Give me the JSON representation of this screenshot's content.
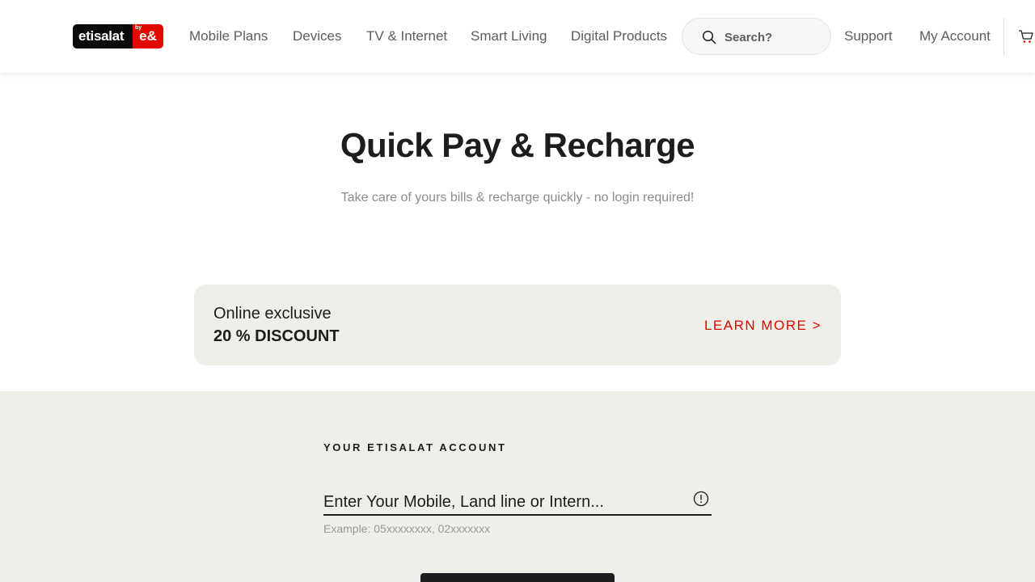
{
  "header": {
    "logo": {
      "text": "etisalat",
      "mark": "e&",
      "by": "by"
    },
    "nav": [
      {
        "label": "Mobile Plans"
      },
      {
        "label": "Devices"
      },
      {
        "label": "TV & Internet"
      },
      {
        "label": "Smart Living"
      },
      {
        "label": "Digital Products"
      }
    ],
    "search": {
      "placeholder": "Search?",
      "icon": "search-icon"
    },
    "links": [
      {
        "label": "Support"
      },
      {
        "label": "My Account"
      }
    ],
    "cart": {
      "icon": "cart-icon"
    }
  },
  "hero": {
    "title": "Quick Pay & Recharge",
    "subtitle": "Take care of yours bills & recharge quickly - no login required!"
  },
  "promo": {
    "line1": "Online exclusive",
    "line2": "20 % DISCOUNT",
    "link": "LEARN MORE >"
  },
  "account": {
    "label": "YOUR ETISALAT ACCOUNT",
    "field_placeholder": "Enter Your Mobile, Land line or Intern...",
    "helper": "Example: 05xxxxxxxx, 02xxxxxxx",
    "info_icon": "info-icon"
  },
  "colors": {
    "brand_red": "#e00800",
    "panel_bg": "#efeee9",
    "text_dark": "#1d1d1d",
    "text_muted": "#8c8c8c"
  }
}
